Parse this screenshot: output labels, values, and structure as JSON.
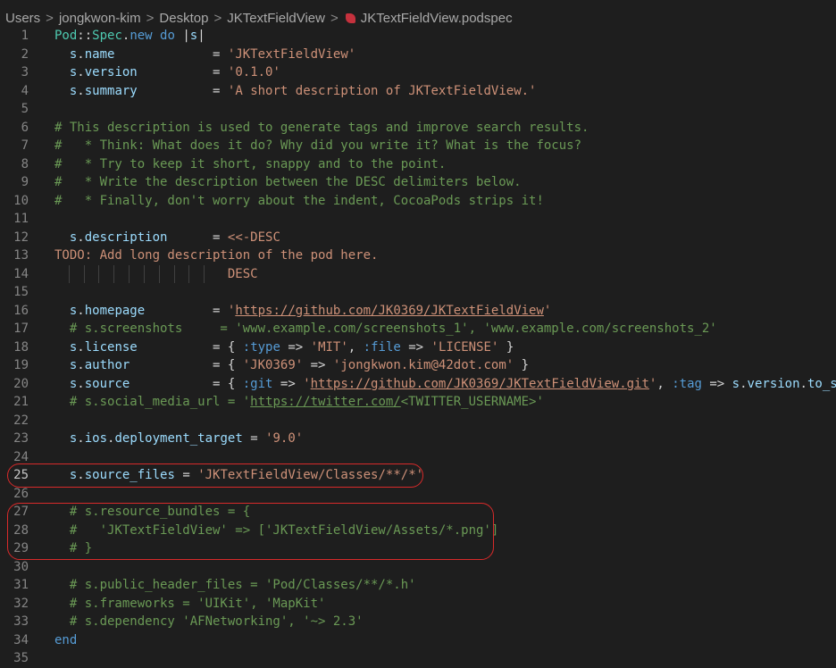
{
  "breadcrumb": [
    "Users",
    "jongkwon-kim",
    "Desktop",
    "JKTextFieldView",
    "JKTextFieldView.podspec"
  ],
  "lines": [
    {
      "n": "1",
      "t": [
        [
          "Pod",
          "const"
        ],
        [
          "::",
          "op"
        ],
        [
          "Spec",
          "const"
        ],
        [
          ".",
          "op"
        ],
        [
          "new",
          "kw"
        ],
        [
          " ",
          "op"
        ],
        [
          "do",
          "kw"
        ],
        [
          " |",
          "op"
        ],
        [
          "s",
          "var"
        ],
        [
          "|",
          "op"
        ]
      ]
    },
    {
      "n": "2",
      "t": [
        [
          "  ",
          "op"
        ],
        [
          "s",
          "var"
        ],
        [
          ".",
          "op"
        ],
        [
          "name",
          "var"
        ],
        [
          "             = ",
          "op"
        ],
        [
          "'JKTextFieldView'",
          "str"
        ]
      ]
    },
    {
      "n": "3",
      "t": [
        [
          "  ",
          "op"
        ],
        [
          "s",
          "var"
        ],
        [
          ".",
          "op"
        ],
        [
          "version",
          "var"
        ],
        [
          "          = ",
          "op"
        ],
        [
          "'0.1.0'",
          "str"
        ]
      ]
    },
    {
      "n": "4",
      "t": [
        [
          "  ",
          "op"
        ],
        [
          "s",
          "var"
        ],
        [
          ".",
          "op"
        ],
        [
          "summary",
          "var"
        ],
        [
          "          = ",
          "op"
        ],
        [
          "'A short description of JKTextFieldView.'",
          "str"
        ]
      ]
    },
    {
      "n": "5",
      "t": []
    },
    {
      "n": "6",
      "t": [
        [
          "# This description is used to generate tags and improve search results.",
          "cmt"
        ]
      ]
    },
    {
      "n": "7",
      "t": [
        [
          "#   * Think: What does it do? Why did you write it? What is the focus?",
          "cmt"
        ]
      ]
    },
    {
      "n": "8",
      "t": [
        [
          "#   * Try to keep it short, snappy and to the point.",
          "cmt"
        ]
      ]
    },
    {
      "n": "9",
      "t": [
        [
          "#   * Write the description between the DESC delimiters below.",
          "cmt"
        ]
      ]
    },
    {
      "n": "10",
      "t": [
        [
          "#   * Finally, don't worry about the indent, CocoaPods strips it!",
          "cmt"
        ]
      ]
    },
    {
      "n": "11",
      "t": []
    },
    {
      "n": "12",
      "t": [
        [
          "  ",
          "op"
        ],
        [
          "s",
          "var"
        ],
        [
          ".",
          "op"
        ],
        [
          "description",
          "var"
        ],
        [
          "      = ",
          "op"
        ],
        [
          "<<-DESC",
          "str"
        ]
      ]
    },
    {
      "n": "13",
      "t": [
        [
          "TODO: Add long description of the pod here.",
          "todo"
        ]
      ]
    },
    {
      "n": "14",
      "t": [
        [
          "                       DESC",
          "str"
        ]
      ]
    },
    {
      "n": "15",
      "t": []
    },
    {
      "n": "16",
      "t": [
        [
          "  ",
          "op"
        ],
        [
          "s",
          "var"
        ],
        [
          ".",
          "op"
        ],
        [
          "homepage",
          "var"
        ],
        [
          "         = ",
          "op"
        ],
        [
          "'",
          "str"
        ],
        [
          "https://github.com/JK0369/JKTextFieldView",
          "str link"
        ],
        [
          "'",
          "str"
        ]
      ]
    },
    {
      "n": "17",
      "t": [
        [
          "  # s.screenshots     = 'www.example.com/screenshots_1', 'www.example.com/screenshots_2'",
          "cmt"
        ]
      ]
    },
    {
      "n": "18",
      "t": [
        [
          "  ",
          "op"
        ],
        [
          "s",
          "var"
        ],
        [
          ".",
          "op"
        ],
        [
          "license",
          "var"
        ],
        [
          "          = { ",
          "op"
        ],
        [
          ":type",
          "sym"
        ],
        [
          " => ",
          "op"
        ],
        [
          "'MIT'",
          "str"
        ],
        [
          ", ",
          "op"
        ],
        [
          ":file",
          "sym"
        ],
        [
          " => ",
          "op"
        ],
        [
          "'LICENSE'",
          "str"
        ],
        [
          " }",
          "op"
        ]
      ]
    },
    {
      "n": "19",
      "t": [
        [
          "  ",
          "op"
        ],
        [
          "s",
          "var"
        ],
        [
          ".",
          "op"
        ],
        [
          "author",
          "var"
        ],
        [
          "           = { ",
          "op"
        ],
        [
          "'JK0369'",
          "str"
        ],
        [
          " => ",
          "op"
        ],
        [
          "'jongkwon.kim@42dot.com'",
          "str"
        ],
        [
          " }",
          "op"
        ]
      ]
    },
    {
      "n": "20",
      "t": [
        [
          "  ",
          "op"
        ],
        [
          "s",
          "var"
        ],
        [
          ".",
          "op"
        ],
        [
          "source",
          "var"
        ],
        [
          "           = { ",
          "op"
        ],
        [
          ":git",
          "sym"
        ],
        [
          " => ",
          "op"
        ],
        [
          "'",
          "str"
        ],
        [
          "https://github.com/JK0369/JKTextFieldView.git",
          "str link"
        ],
        [
          "'",
          "str"
        ],
        [
          ", ",
          "op"
        ],
        [
          ":tag",
          "sym"
        ],
        [
          " => ",
          "op"
        ],
        [
          "s",
          "var"
        ],
        [
          ".",
          "op"
        ],
        [
          "version",
          "var"
        ],
        [
          ".",
          "op"
        ],
        [
          "to_s",
          "var"
        ],
        [
          " }",
          "op"
        ]
      ]
    },
    {
      "n": "21",
      "t": [
        [
          "  # s.social_media_url = '",
          "cmt"
        ],
        [
          "https://twitter.com/",
          "cmt link"
        ],
        [
          "<TWITTER_USERNAME>'",
          "cmt"
        ]
      ]
    },
    {
      "n": "22",
      "t": []
    },
    {
      "n": "23",
      "t": [
        [
          "  ",
          "op"
        ],
        [
          "s",
          "var"
        ],
        [
          ".",
          "op"
        ],
        [
          "ios",
          "var"
        ],
        [
          ".",
          "op"
        ],
        [
          "deployment_target",
          "var"
        ],
        [
          " = ",
          "op"
        ],
        [
          "'9.0'",
          "str"
        ]
      ]
    },
    {
      "n": "24",
      "t": []
    },
    {
      "n": "25",
      "t": [
        [
          "  ",
          "op"
        ],
        [
          "s",
          "var"
        ],
        [
          ".",
          "op"
        ],
        [
          "source_files",
          "var"
        ],
        [
          " = ",
          "op"
        ],
        [
          "'JKTextFieldView/Classes/**/*'",
          "str"
        ]
      ]
    },
    {
      "n": "26",
      "t": []
    },
    {
      "n": "27",
      "t": [
        [
          "  # s.resource_bundles = {",
          "cmt"
        ]
      ]
    },
    {
      "n": "28",
      "t": [
        [
          "  #   'JKTextFieldView' => ['JKTextFieldView/Assets/*.png']",
          "cmt"
        ]
      ]
    },
    {
      "n": "29",
      "t": [
        [
          "  # }",
          "cmt"
        ]
      ]
    },
    {
      "n": "30",
      "t": []
    },
    {
      "n": "31",
      "t": [
        [
          "  # s.public_header_files = 'Pod/Classes/**/*.h'",
          "cmt"
        ]
      ]
    },
    {
      "n": "32",
      "t": [
        [
          "  # s.frameworks = 'UIKit', 'MapKit'",
          "cmt"
        ]
      ]
    },
    {
      "n": "33",
      "t": [
        [
          "  # s.dependency 'AFNetworking', '~> 2.3'",
          "cmt"
        ]
      ]
    },
    {
      "n": "34",
      "t": [
        [
          "end",
          "kw"
        ]
      ]
    },
    {
      "n": "35",
      "t": []
    }
  ],
  "colors": {
    "background": "#1e1e1e",
    "keyword": "#569cd6",
    "constant": "#4ec9b0",
    "variable": "#9cdcfe",
    "string": "#ce9178",
    "comment": "#6a9955",
    "annotation": "#d82a2a"
  }
}
